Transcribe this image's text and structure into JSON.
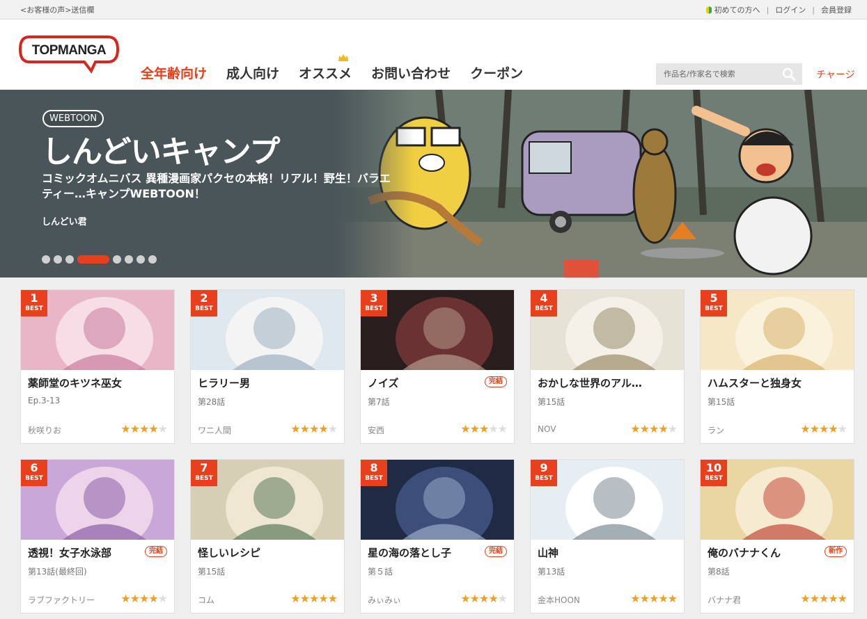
{
  "topbar": {
    "feedback": "<お客様の声>送信欄",
    "beginner": "初めての方へ",
    "login": "ログイン",
    "register": "会員登録",
    "sep": "|"
  },
  "header": {
    "logo_text": "TOPMANGA",
    "nav": [
      {
        "label": "全年齢向け",
        "active": true
      },
      {
        "label": "成人向け",
        "active": false
      },
      {
        "label": "オススメ",
        "active": false
      },
      {
        "label": "お問い合わせ",
        "active": false
      },
      {
        "label": "クーポン",
        "active": false
      }
    ],
    "search_placeholder": "作品名/作家名で検索",
    "charge": "チャージ"
  },
  "hero": {
    "badge": "WEBTOON",
    "title": "しんどいキャンプ",
    "description": "コミックオムニバス 異種漫画家パクセの本格！リアル！野生！バラエティー…キャンプWEBTOON！",
    "author": "しんどい君",
    "slides": 8,
    "active_slide": 4
  },
  "colors": {
    "accent": "#e8401c",
    "star": "#f0a020"
  },
  "cards": [
    {
      "rank": "1",
      "best": "BEST",
      "title": "薬師堂のキツネ巫女",
      "episode": "Ep.3-13",
      "author": "秋咲りお",
      "rating": 4,
      "tag": ""
    },
    {
      "rank": "2",
      "best": "BEST",
      "title": "ヒラリー男",
      "episode": "第28話",
      "author": "ワニ人間",
      "rating": 4,
      "tag": ""
    },
    {
      "rank": "3",
      "best": "BEST",
      "title": "ノイズ",
      "episode": "第7話",
      "author": "安西",
      "rating": 3,
      "tag": "完結"
    },
    {
      "rank": "4",
      "best": "BEST",
      "title": "おかしな世界のアル…",
      "episode": "第15話",
      "author": "NOV",
      "rating": 4,
      "tag": ""
    },
    {
      "rank": "5",
      "best": "BEST",
      "title": "ハムスターと独身女",
      "episode": "第15話",
      "author": "ラン",
      "rating": 4,
      "tag": ""
    },
    {
      "rank": "6",
      "best": "BEST",
      "title": "透視！女子水泳部",
      "episode": "第13話(最終回)",
      "author": "ラブファクトリー",
      "rating": 4,
      "tag": "完結"
    },
    {
      "rank": "7",
      "best": "BEST",
      "title": "怪しいレシピ",
      "episode": "第15話",
      "author": "コム",
      "rating": 5,
      "tag": ""
    },
    {
      "rank": "8",
      "best": "BEST",
      "title": "星の海の落とし子",
      "episode": "第５話",
      "author": "みぃみぃ",
      "rating": 4,
      "tag": "完結"
    },
    {
      "rank": "9",
      "best": "BEST",
      "title": "山神",
      "episode": "第13話",
      "author": "金本HOON",
      "rating": 5,
      "tag": ""
    },
    {
      "rank": "10",
      "best": "BEST",
      "title": "俺のバナナくん",
      "episode": "第8話",
      "author": "バナナ君",
      "rating": 5,
      "tag": "新作"
    }
  ]
}
